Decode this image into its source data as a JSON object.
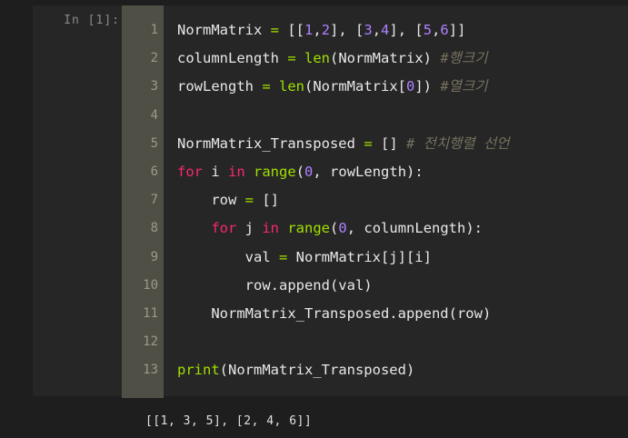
{
  "cell": {
    "prompt": "In [1]:",
    "lines": [
      {
        "num": "1",
        "tokens": [
          {
            "t": "NormMatrix ",
            "c": "var"
          },
          {
            "t": "=",
            "c": "op"
          },
          {
            "t": " [[",
            "c": "var"
          },
          {
            "t": "1",
            "c": "num"
          },
          {
            "t": ",",
            "c": "var"
          },
          {
            "t": "2",
            "c": "num"
          },
          {
            "t": "], [",
            "c": "var"
          },
          {
            "t": "3",
            "c": "num"
          },
          {
            "t": ",",
            "c": "var"
          },
          {
            "t": "4",
            "c": "num"
          },
          {
            "t": "], [",
            "c": "var"
          },
          {
            "t": "5",
            "c": "num"
          },
          {
            "t": ",",
            "c": "var"
          },
          {
            "t": "6",
            "c": "num"
          },
          {
            "t": "]]",
            "c": "var"
          }
        ]
      },
      {
        "num": "2",
        "tokens": [
          {
            "t": "columnLength ",
            "c": "var"
          },
          {
            "t": "=",
            "c": "op"
          },
          {
            "t": " ",
            "c": "var"
          },
          {
            "t": "len",
            "c": "fn"
          },
          {
            "t": "(NormMatrix) ",
            "c": "var"
          },
          {
            "t": "#행크기",
            "c": "cm"
          }
        ]
      },
      {
        "num": "3",
        "tokens": [
          {
            "t": "rowLength ",
            "c": "var"
          },
          {
            "t": "=",
            "c": "op"
          },
          {
            "t": " ",
            "c": "var"
          },
          {
            "t": "len",
            "c": "fn"
          },
          {
            "t": "(NormMatrix[",
            "c": "var"
          },
          {
            "t": "0",
            "c": "num"
          },
          {
            "t": "]) ",
            "c": "var"
          },
          {
            "t": "#열크기",
            "c": "cm"
          }
        ]
      },
      {
        "num": "4",
        "tokens": []
      },
      {
        "num": "5",
        "tokens": [
          {
            "t": "NormMatrix_Transposed ",
            "c": "var"
          },
          {
            "t": "=",
            "c": "op"
          },
          {
            "t": " [] ",
            "c": "var"
          },
          {
            "t": "# 전치행렬 선언",
            "c": "cm"
          }
        ]
      },
      {
        "num": "6",
        "tokens": [
          {
            "t": "for",
            "c": "kw"
          },
          {
            "t": " i ",
            "c": "var"
          },
          {
            "t": "in",
            "c": "kw"
          },
          {
            "t": " ",
            "c": "var"
          },
          {
            "t": "range",
            "c": "fn"
          },
          {
            "t": "(",
            "c": "var"
          },
          {
            "t": "0",
            "c": "num"
          },
          {
            "t": ", rowLength):",
            "c": "var"
          }
        ]
      },
      {
        "num": "7",
        "tokens": [
          {
            "t": "    row ",
            "c": "var"
          },
          {
            "t": "=",
            "c": "op"
          },
          {
            "t": " []",
            "c": "var"
          }
        ]
      },
      {
        "num": "8",
        "tokens": [
          {
            "t": "    ",
            "c": "var"
          },
          {
            "t": "for",
            "c": "kw"
          },
          {
            "t": " j ",
            "c": "var"
          },
          {
            "t": "in",
            "c": "kw"
          },
          {
            "t": " ",
            "c": "var"
          },
          {
            "t": "range",
            "c": "fn"
          },
          {
            "t": "(",
            "c": "var"
          },
          {
            "t": "0",
            "c": "num"
          },
          {
            "t": ", columnLength):",
            "c": "var"
          }
        ]
      },
      {
        "num": "9",
        "tokens": [
          {
            "t": "        val ",
            "c": "var"
          },
          {
            "t": "=",
            "c": "op"
          },
          {
            "t": " NormMatrix[j][i]",
            "c": "var"
          }
        ]
      },
      {
        "num": "10",
        "tokens": [
          {
            "t": "        row.append(val)",
            "c": "var"
          }
        ]
      },
      {
        "num": "11",
        "tokens": [
          {
            "t": "    NormMatrix_Transposed.append(row)",
            "c": "var"
          }
        ]
      },
      {
        "num": "12",
        "tokens": []
      },
      {
        "num": "13",
        "tokens": [
          {
            "t": "print",
            "c": "fn"
          },
          {
            "t": "(NormMatrix_Transposed)",
            "c": "var"
          }
        ]
      }
    ]
  },
  "output": {
    "text": "[[1, 3, 5], [2, 4, 6]]"
  }
}
